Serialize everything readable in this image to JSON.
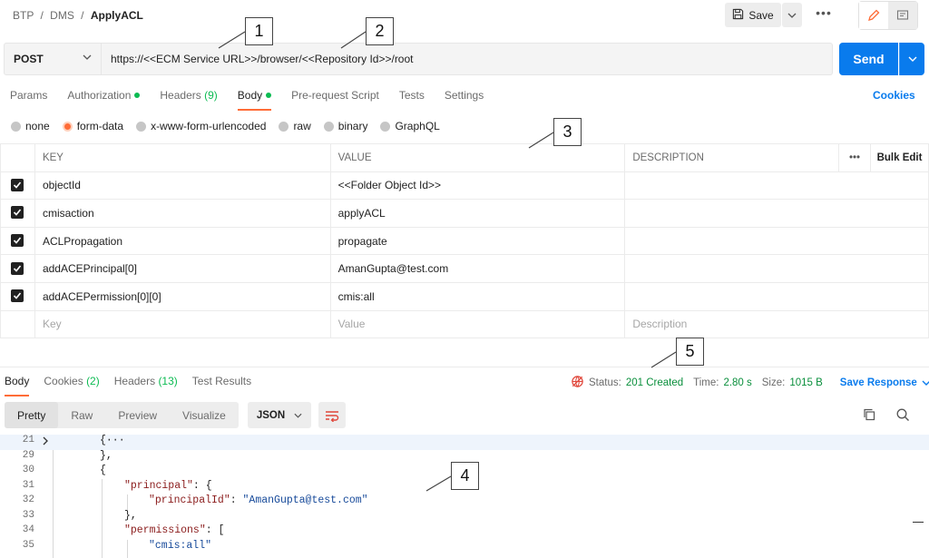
{
  "breadcrumb": {
    "part1": "BTP",
    "sep": "/",
    "part2": "DMS",
    "current": "ApplyACL"
  },
  "toolbar": {
    "save_label": "Save",
    "more_label": "•••"
  },
  "request": {
    "method": "POST",
    "url": "https://<<ECM Service URL>>/browser/<<Repository Id>>/root",
    "send_label": "Send"
  },
  "req_tabs": [
    {
      "label": "Params"
    },
    {
      "label": "Authorization"
    },
    {
      "label": "Headers",
      "count": "(9)"
    },
    {
      "label": "Body"
    },
    {
      "label": "Pre-request Script"
    },
    {
      "label": "Tests"
    },
    {
      "label": "Settings"
    }
  ],
  "cookies_label": "Cookies",
  "body_types": [
    "none",
    "form-data",
    "x-www-form-urlencoded",
    "raw",
    "binary",
    "GraphQL"
  ],
  "kv": {
    "headers": {
      "key": "KEY",
      "value": "VALUE",
      "description": "DESCRIPTION",
      "more": "•••",
      "bulk": "Bulk Edit"
    },
    "rows": [
      {
        "key": "objectId",
        "value": "<<Folder Object Id>>"
      },
      {
        "key": "cmisaction",
        "value": "applyACL"
      },
      {
        "key": "ACLPropagation",
        "value": "propagate"
      },
      {
        "key": "addACEPrincipal[0]",
        "value": "AmanGupta@test.com"
      },
      {
        "key": "addACEPermission[0][0]",
        "value": "cmis:all"
      }
    ],
    "placeholder": {
      "key": "Key",
      "value": "Value",
      "description": "Description"
    }
  },
  "response": {
    "tabs": [
      {
        "label": "Body"
      },
      {
        "label": "Cookies",
        "count": "(2)"
      },
      {
        "label": "Headers",
        "count": "(13)"
      },
      {
        "label": "Test Results"
      }
    ],
    "status_label": "Status:",
    "status_value": "201 Created",
    "time_label": "Time:",
    "time_value": "2.80 s",
    "size_label": "Size:",
    "size_value": "1015 B",
    "save_response": "Save Response",
    "views": [
      "Pretty",
      "Raw",
      "Preview",
      "Visualize"
    ],
    "format": "JSON"
  },
  "code": {
    "lines": [
      {
        "n": "21",
        "text": "{···"
      },
      {
        "n": "29",
        "text": "},"
      },
      {
        "n": "30",
        "text": "{"
      },
      {
        "n": "31",
        "key": "\"principal\"",
        "rest": ": {"
      },
      {
        "n": "32",
        "key": "\"principalId\"",
        "rest": ": ",
        "str": "\"AmanGupta@test.com\""
      },
      {
        "n": "33",
        "text": "},"
      },
      {
        "n": "34",
        "key": "\"permissions\"",
        "rest": ": ["
      },
      {
        "n": "35",
        "str": "\"cmis:all\""
      }
    ]
  },
  "callouts": [
    "1",
    "2",
    "3",
    "4",
    "5"
  ],
  "colors": {
    "accent": "#ff6c37",
    "primary": "#097bed",
    "success": "#0cbb52"
  }
}
